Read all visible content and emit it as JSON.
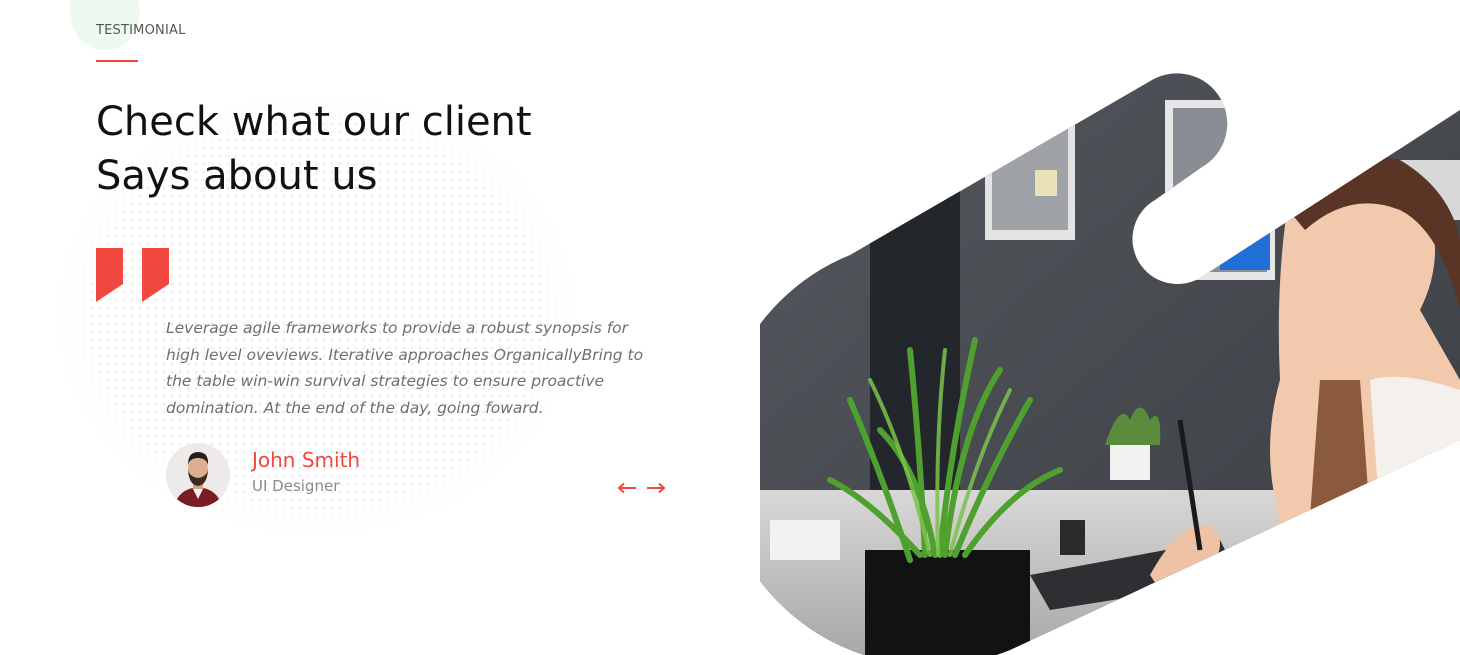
{
  "section": {
    "eyebrow": "TESTIMONIAL",
    "headline_line1": "Check what our client",
    "headline_line2": "Says about us"
  },
  "testimonial": {
    "quote": "Leverage agile frameworks to provide a robust synopsis for high level oveviews. Iterative approaches OrganicallyBring to the table win-win survival strategies to ensure proactive domination. At the end of the day, going foward.",
    "author_name": "John Smith",
    "author_role": "UI Designer"
  },
  "navigation": {
    "prev_icon": "arrow-left-icon",
    "next_icon": "arrow-right-icon"
  },
  "colors": {
    "accent": "#f0483e",
    "heading": "#111111",
    "body_text": "#6f6f6f"
  },
  "icons": {
    "quote": "quote-icon",
    "avatar": "avatar-image",
    "hero": "office-photo"
  }
}
